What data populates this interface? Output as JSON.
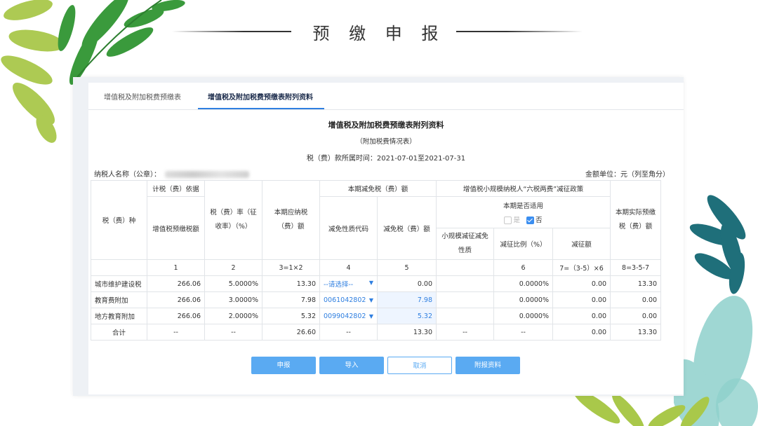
{
  "slide": {
    "title": "预 缴 申 报"
  },
  "tabs": [
    {
      "label": "增值税及附加税费预缴表"
    },
    {
      "label": "增值税及附加税费预缴表附列资料"
    }
  ],
  "doc": {
    "title": "增值税及附加税费预缴表附列资料",
    "subtitle": "（附加税费情况表）",
    "period": "税（费）款所属时间：2021-07-01至2021-07-31",
    "taxpayer_label": "纳税人名称（公章）：",
    "unit": "金额单位：元（列至角分）"
  },
  "table": {
    "headers": {
      "tax_type": "税（费）种",
      "basis_group": "计税（费）依据",
      "basis_col": "增值税预缴税额",
      "rate": "税（费）率（征收率）（%）",
      "payable": "本期应纳税（费）额",
      "reduction_group": "本期减免税（费）额",
      "reduction_code": "减免性质代码",
      "reduction_amount": "减免税（费）额",
      "policy_group": "增值税小规模纳税人“六税两费”减征政策",
      "applicable": "本期是否适用",
      "yes": "是",
      "no": "否",
      "small_code": "小规模减征减免性质",
      "ratio": "减征比例（%）",
      "reduce_amount": "减征额",
      "actual": "本期实际预缴税（费）额"
    },
    "col_numbers": [
      "1",
      "2",
      "3=1×2",
      "4",
      "5",
      "6",
      "7=（3-5）×6",
      "8=3-5-7"
    ],
    "rows": [
      {
        "name": "城市维护建设税",
        "basis": "266.06",
        "rate": "5.0000%",
        "payable": "13.30",
        "code": "--请选择--",
        "reduction": "0.00",
        "small": "",
        "ratio": "0.0000%",
        "reduce": "0.00",
        "actual": "13.30"
      },
      {
        "name": "教育费附加",
        "basis": "266.06",
        "rate": "3.0000%",
        "payable": "7.98",
        "code": "0061042802",
        "reduction": "7.98",
        "small": "",
        "ratio": "0.0000%",
        "reduce": "0.00",
        "actual": "0.00"
      },
      {
        "name": "地方教育附加",
        "basis": "266.06",
        "rate": "2.0000%",
        "payable": "5.32",
        "code": "0099042802",
        "reduction": "5.32",
        "small": "",
        "ratio": "0.0000%",
        "reduce": "0.00",
        "actual": "0.00"
      }
    ],
    "total": {
      "name": "合计",
      "basis": "--",
      "rate": "--",
      "payable": "26.60",
      "code": "--",
      "reduction": "13.30",
      "small": "--",
      "ratio": "--",
      "reduce": "0.00",
      "actual": "13.30"
    }
  },
  "buttons": {
    "submit": "申报",
    "import": "导入",
    "cancel": "取消",
    "attach": "附报资料"
  },
  "colors": {
    "accent": "#2f7fe0",
    "button": "#5aaaf2",
    "leaf_green": "#3a9a3c",
    "leaf_lime": "#a9c84a",
    "leaf_teal": "#1f6f7a"
  }
}
